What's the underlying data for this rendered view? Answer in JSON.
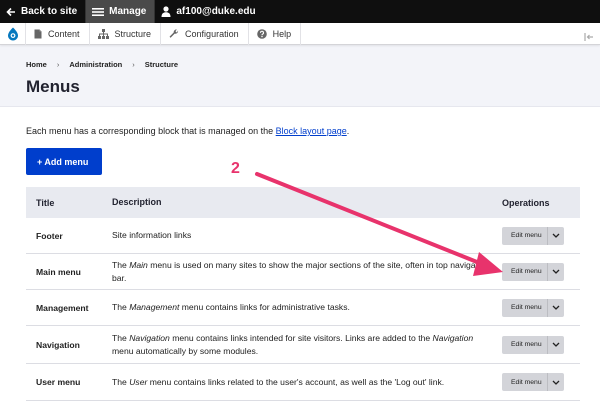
{
  "toolbar": {
    "back_label": "Back to site",
    "manage_label": "Manage",
    "user_label": "af100@duke.edu"
  },
  "tray": {
    "items": [
      {
        "label": "Content",
        "icon": "document-icon"
      },
      {
        "label": "Structure",
        "icon": "sitemap-icon"
      },
      {
        "label": "Configuration",
        "icon": "wrench-icon"
      },
      {
        "label": "Help",
        "icon": "help-icon"
      }
    ]
  },
  "breadcrumb": [
    "Home",
    "Administration",
    "Structure"
  ],
  "page_title": "Menus",
  "description": {
    "prefix": "Each menu has a corresponding block that is managed on the ",
    "link": "Block layout page",
    "suffix": "."
  },
  "add_menu_label": "+ Add menu",
  "table": {
    "headers": {
      "title": "Title",
      "description": "Description",
      "operations": "Operations"
    },
    "rows": [
      {
        "title": "Footer",
        "pre": "Site information links",
        "em": "",
        "post": "",
        "height": 36
      },
      {
        "title": "Main menu",
        "pre": "The ",
        "em": "Main",
        "post": " menu is used on many sites to show the major sections of the site, often in top navigation bar.",
        "height": 36
      },
      {
        "title": "Management",
        "pre": "The ",
        "em": "Management",
        "post": " menu contains links for administrative tasks.",
        "height": 36
      },
      {
        "title": "Navigation",
        "pre": "The ",
        "em": "Navigation",
        "post": " menu contains links intended for site visitors. Links are added to the ",
        "em2": "Navigation",
        "post2": " menu automatically by some modules.",
        "height": 38
      },
      {
        "title": "User menu",
        "pre": "The ",
        "em": "User",
        "post": " menu contains links related to the user's account, as well as the 'Log out' link.",
        "height": 37
      }
    ],
    "edit_label": "Edit menu"
  },
  "annotation": {
    "number": "2",
    "color": "#e8336c"
  }
}
